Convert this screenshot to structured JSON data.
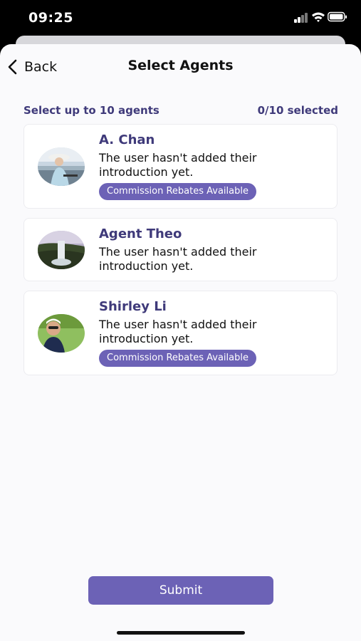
{
  "status_bar": {
    "time": "09:25",
    "icons": [
      "signal-icon",
      "wifi-icon",
      "battery-icon"
    ]
  },
  "nav": {
    "back_label": "Back",
    "title": "Select Agents"
  },
  "selection": {
    "hint": "Select up to 10 agents",
    "count": "0/10 selected"
  },
  "agents": [
    {
      "name": "A. Chan",
      "intro": "The user hasn't added their introduction yet.",
      "badge": "Commission Rebates Available"
    },
    {
      "name": "Agent Theo",
      "intro": "The user hasn't added their introduction yet.",
      "badge": ""
    },
    {
      "name": "Shirley Li",
      "intro": "The user hasn't added their introduction yet.",
      "badge": "Commission Rebates Available"
    }
  ],
  "submit_label": "Submit",
  "colors": {
    "accent": "#6c62b6",
    "heading": "#3f3a7a",
    "background": "#fafafc"
  }
}
